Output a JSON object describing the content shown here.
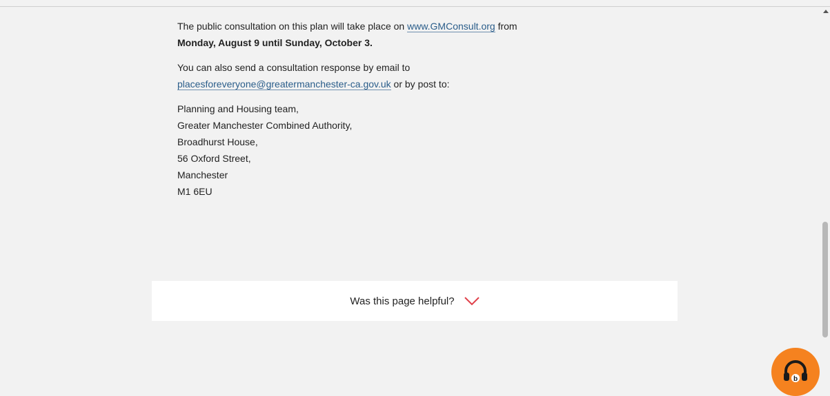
{
  "content": {
    "para1_text": "The public consultation on this plan will take place on ",
    "para1_link": "www.GMConsult.org",
    "para1_after": " from",
    "para1_bold": "Monday, August 9 until Sunday, October 3.",
    "para2_text": "You can also send a consultation response by email to",
    "para2_link": "placesforeveryone@greatermanchester-ca.gov.uk",
    "para2_after": " or by post to:",
    "address": [
      "Planning and Housing team,",
      "Greater Manchester Combined Authority,",
      "Broadhurst House,",
      "56 Oxford Street,",
      "Manchester",
      "M1 6EU"
    ]
  },
  "feedback": {
    "label": "Was this page helpful?",
    "chevron_icon": "chevron-down-icon",
    "chevron_color": "#e0404a"
  },
  "widget": {
    "icon": "headphones-icon",
    "color": "#f5821f"
  }
}
